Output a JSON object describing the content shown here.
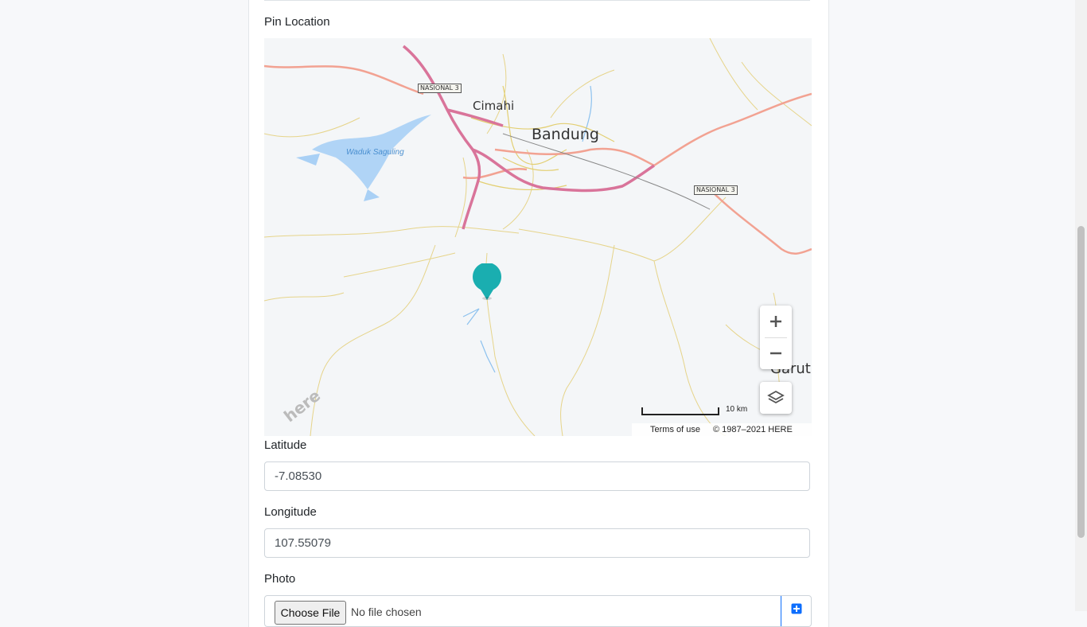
{
  "pin_section": {
    "label": "Pin Location"
  },
  "map": {
    "cities": {
      "bandung": "Bandung",
      "cimahi": "Cimahi",
      "garut": "Garut"
    },
    "lake": "Waduk Saguling",
    "road_shields": [
      "NASIONAL 3",
      "NASIONAL 3"
    ],
    "brand": "here",
    "scale": "10 km",
    "terms": "Terms of use",
    "copyright": "© 1987–2021 HERE",
    "pin_color": "#1aaeb0",
    "highway_color": "#d9749a",
    "primary_road_color": "#f09a8a",
    "minor_road_color": "#e8d27a"
  },
  "latitude": {
    "label": "Latitude",
    "value": "-7.08530"
  },
  "longitude": {
    "label": "Longitude",
    "value": "107.55079"
  },
  "photo": {
    "label": "Photo",
    "button": "Choose File",
    "status": "No file chosen"
  }
}
